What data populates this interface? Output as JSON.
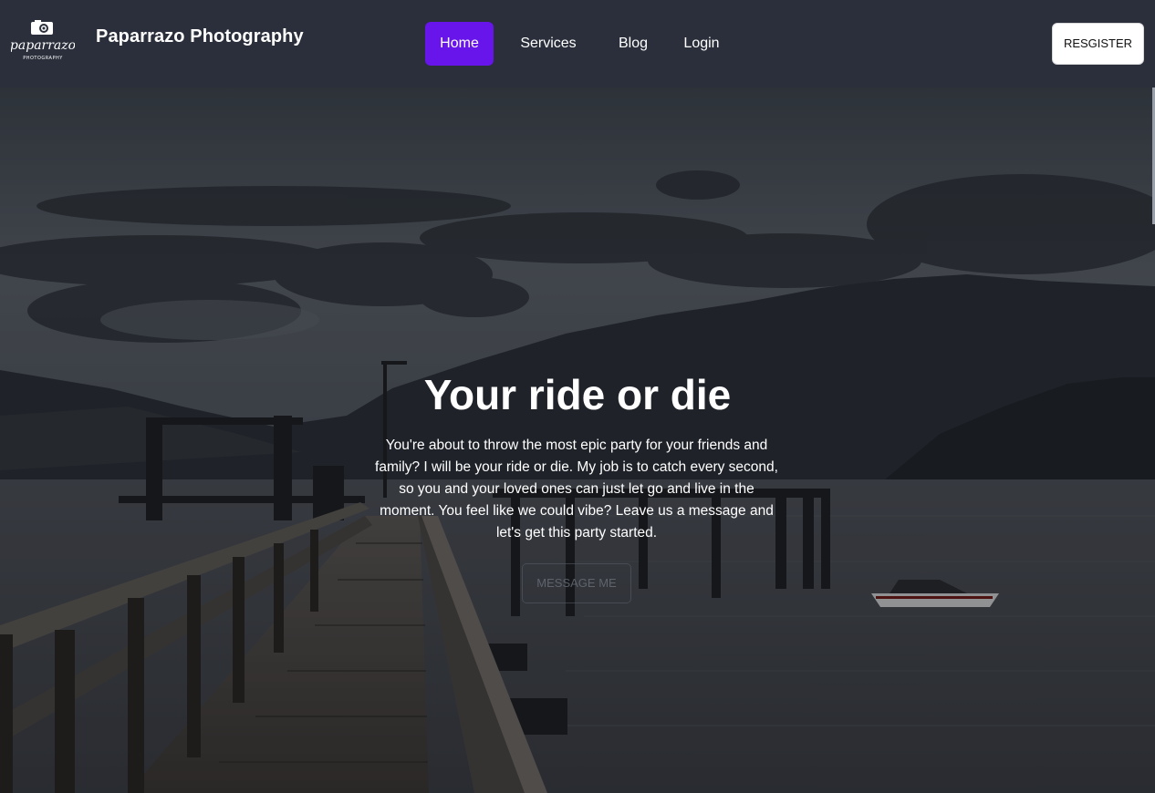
{
  "header": {
    "brand": "Paparrazo Photography",
    "logo_text": "paparrazo",
    "logo_subtext": "PHOTOGRAPHY",
    "nav": [
      {
        "label": "Home",
        "active": true
      },
      {
        "label": "Services",
        "active": false
      },
      {
        "label": "Blog",
        "active": false
      },
      {
        "label": "Login",
        "active": false
      }
    ],
    "register_label": "RESGISTER"
  },
  "hero": {
    "title": "Your ride or die",
    "description": "You're about to throw the most epic party for your friends and family? I will be your ride or die. My job is to catch every second, so you and your loved ones can just let go and live in the moment. You feel like we could vibe? Leave us a message and let's get this party started.",
    "cta_label": "MESSAGE ME"
  },
  "colors": {
    "navbar_bg": "#2a2f3b",
    "active_nav": "#6715ea",
    "text": "#ffffff"
  },
  "icons": {
    "logo": "camera-icon"
  }
}
